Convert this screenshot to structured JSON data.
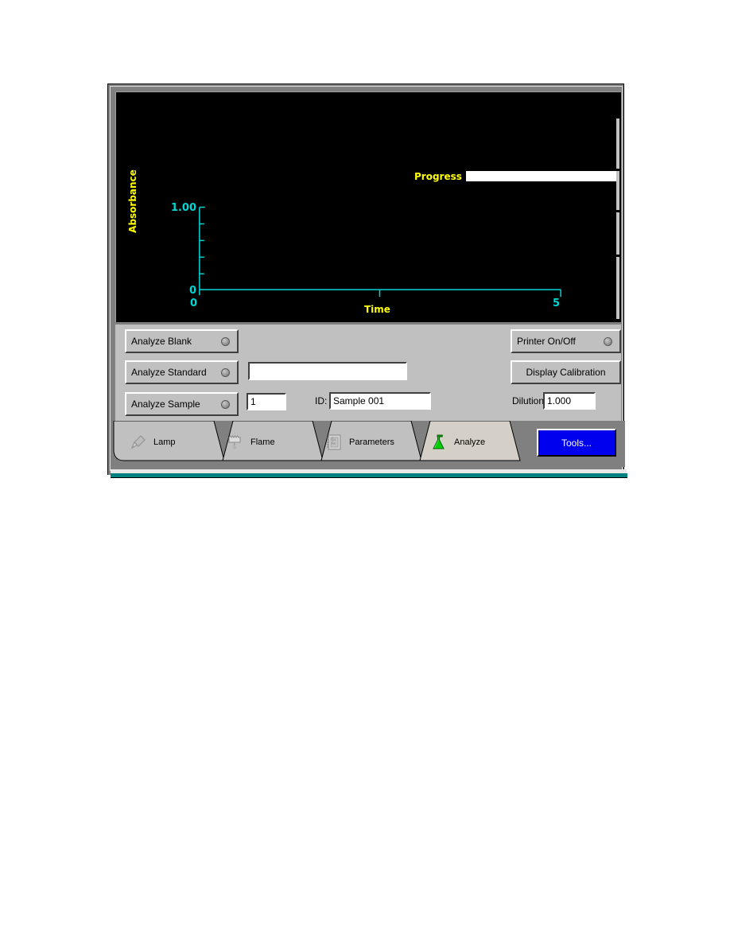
{
  "window": {
    "background_color": "#808080",
    "panel_color": "#c0c0c0",
    "footer_color": "#008080"
  },
  "graph": {
    "background_color": "#000000",
    "axis_color": "#00d6d6",
    "label_color": "#ffff00"
  },
  "progress": {
    "label": "Progress",
    "value_percent": 0,
    "bar_background": "#ffffff"
  },
  "controls": {
    "analyze_blank_label": "Analyze Blank",
    "analyze_standard_label": "Analyze Standard",
    "analyze_sample_label": "Analyze Sample",
    "standard_value": "",
    "standard_placeholder": "",
    "sample_number_value": "1",
    "id_label": "ID:",
    "sample_id_value": "Sample 001",
    "dilution_label": "Dilution:",
    "dilution_value": "1.000",
    "printer_label": "Printer On/Off",
    "display_calibration_label": "Display Calibration"
  },
  "tabs": [
    {
      "label": "Lamp",
      "icon": "lamp-icon",
      "active": false
    },
    {
      "label": "Flame",
      "icon": "burner-icon",
      "active": false
    },
    {
      "label": "Parameters",
      "icon": "parameters-list-icon",
      "active": false
    },
    {
      "label": "Analyze",
      "icon": "flask-icon",
      "active": true
    }
  ],
  "tools_button": {
    "label": "Tools...",
    "color": "#0000ee"
  },
  "chart_data": {
    "type": "line",
    "title": "",
    "xlabel": "Time",
    "ylabel": "Absorbance",
    "xlim": [
      0,
      5
    ],
    "ylim": [
      0,
      1.0
    ],
    "xticks": [
      0,
      5
    ],
    "xtick_labels": [
      "0",
      "5"
    ],
    "yticks": [
      0,
      0.2,
      0.4,
      0.6,
      0.8,
      1.0
    ],
    "ytick_labels": [
      "0",
      "",
      "",
      "",
      "",
      "1.00"
    ],
    "grid": false,
    "legend": false,
    "series": [
      {
        "name": "Absorbance",
        "x": [],
        "y": []
      }
    ]
  }
}
